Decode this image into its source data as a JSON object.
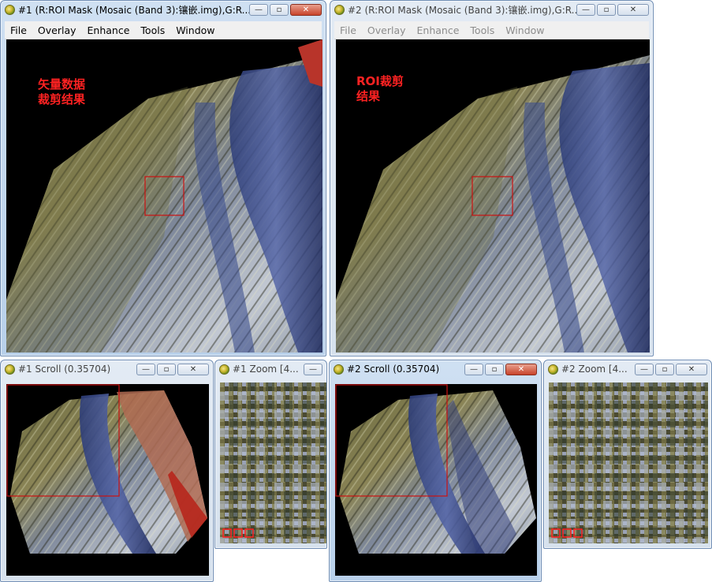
{
  "windows": {
    "image1": {
      "title": "#1 (R:ROI Mask (Mosaic (Band 3):镶嵌.img),G:R...",
      "menu": [
        "File",
        "Overlay",
        "Enhance",
        "Tools",
        "Window"
      ],
      "annotation": "矢量数据\n裁剪结果"
    },
    "image2": {
      "title": "#2 (R:ROI Mask (Mosaic (Band 3):镶嵌.img),G:R...",
      "menu": [
        "File",
        "Overlay",
        "Enhance",
        "Tools",
        "Window"
      ],
      "annotation": "ROI裁剪\n结果"
    },
    "scroll1": {
      "title": "#1 Scroll (0.35704)"
    },
    "zoom1": {
      "title": "#1 Zoom [4..."
    },
    "scroll2": {
      "title": "#2 Scroll (0.35704)"
    },
    "zoom2": {
      "title": "#2 Zoom [4..."
    }
  },
  "window_controls": {
    "minimize": "—",
    "maximize": "▫",
    "close": "✕"
  },
  "colors": {
    "annotation": "#ff2222",
    "roi_box": "#cc1111",
    "titlebar_active": "#cfe0f2",
    "titlebar_inactive": "#e3ebf4"
  },
  "icons": {
    "app": "envi-globe-icon"
  }
}
